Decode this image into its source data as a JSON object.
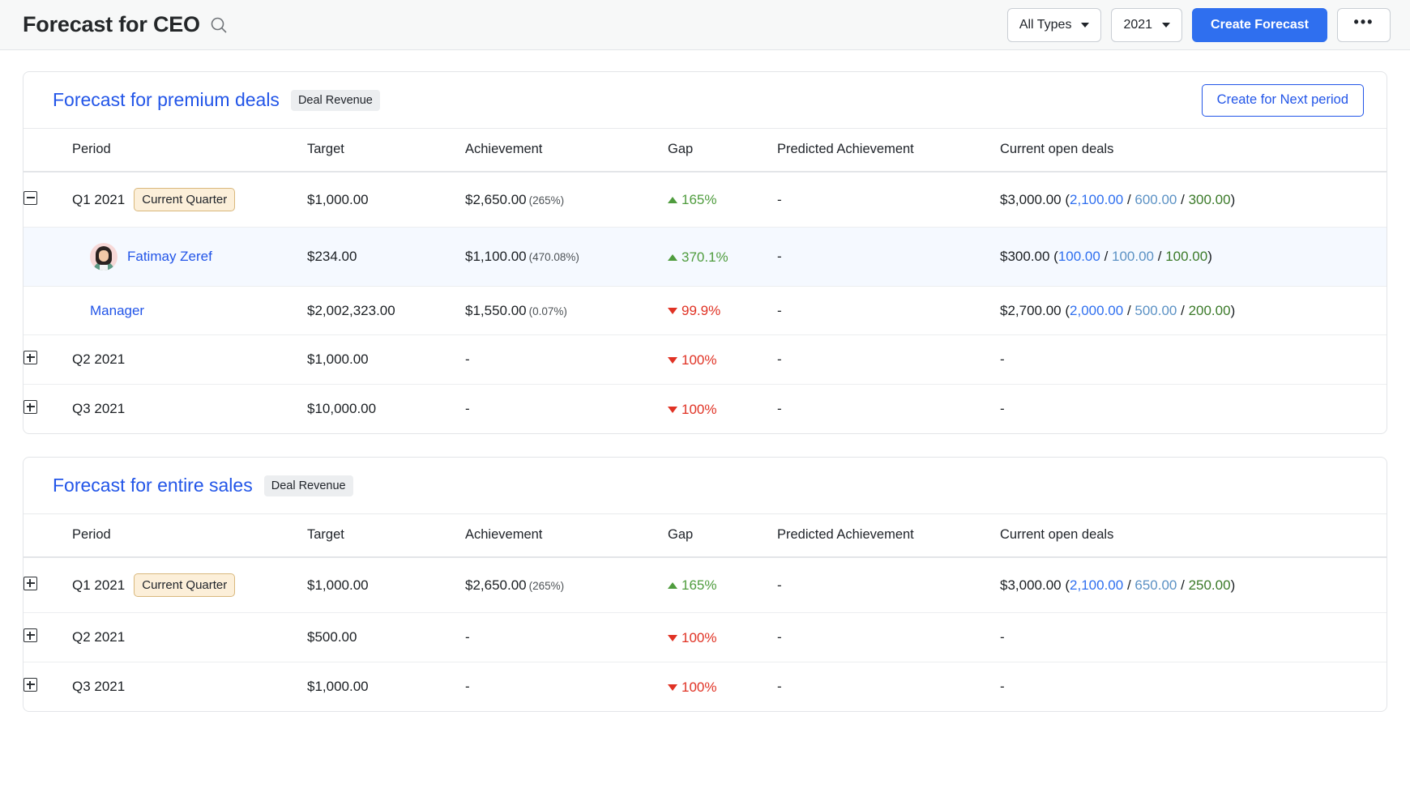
{
  "header": {
    "title": "Forecast for CEO",
    "search_icon": "search-icon",
    "type_filter": "All Types",
    "year_filter": "2021",
    "create_button": "Create Forecast",
    "more_button": "•••"
  },
  "columns": [
    "Period",
    "Target",
    "Achievement",
    "Gap",
    "Predicted Achievement",
    "Current open deals"
  ],
  "cards": [
    {
      "title": "Forecast for premium deals",
      "tag": "Deal Revenue",
      "action": "Create for Next period",
      "rows": [
        {
          "toggle": "minus",
          "type": "period",
          "period": "Q1 2021",
          "badge": "Current Quarter",
          "target": "$1,000.00",
          "achievement": "$2,650.00",
          "achievement_pct": "(265%)",
          "gap": "165%",
          "gap_dir": "up",
          "predicted": "-",
          "open_total": "$3,000.00",
          "open_a": "2,100.00",
          "open_b": "600.00",
          "open_c": "300.00",
          "highlight": false
        },
        {
          "toggle": "none",
          "type": "user",
          "period": "Fatimay Zeref",
          "badge": "",
          "target": "$234.00",
          "achievement": "$1,100.00",
          "achievement_pct": "(470.08%)",
          "gap": "370.1%",
          "gap_dir": "up",
          "predicted": "-",
          "open_total": "$300.00",
          "open_a": "100.00",
          "open_b": "100.00",
          "open_c": "100.00",
          "highlight": true
        },
        {
          "toggle": "none",
          "type": "manager",
          "period": "Manager",
          "badge": "",
          "target": "$2,002,323.00",
          "achievement": "$1,550.00",
          "achievement_pct": "(0.07%)",
          "gap": "99.9%",
          "gap_dir": "down",
          "predicted": "-",
          "open_total": "$2,700.00",
          "open_a": "2,000.00",
          "open_b": "500.00",
          "open_c": "200.00",
          "highlight": false
        },
        {
          "toggle": "plus",
          "type": "period",
          "period": "Q2 2021",
          "badge": "",
          "target": "$1,000.00",
          "achievement": "-",
          "achievement_pct": "",
          "gap": "100%",
          "gap_dir": "down",
          "predicted": "-",
          "open_total": "-",
          "open_a": "",
          "open_b": "",
          "open_c": "",
          "highlight": false
        },
        {
          "toggle": "plus",
          "type": "period",
          "period": "Q3 2021",
          "badge": "",
          "target": "$10,000.00",
          "achievement": "-",
          "achievement_pct": "",
          "gap": "100%",
          "gap_dir": "down",
          "predicted": "-",
          "open_total": "-",
          "open_a": "",
          "open_b": "",
          "open_c": "",
          "highlight": false
        }
      ]
    },
    {
      "title": "Forecast for entire sales",
      "tag": "Deal Revenue",
      "action": "",
      "rows": [
        {
          "toggle": "plus",
          "type": "period",
          "period": "Q1 2021",
          "badge": "Current Quarter",
          "target": "$1,000.00",
          "achievement": "$2,650.00",
          "achievement_pct": "(265%)",
          "gap": "165%",
          "gap_dir": "up",
          "predicted": "-",
          "open_total": "$3,000.00",
          "open_a": "2,100.00",
          "open_b": "650.00",
          "open_c": "250.00",
          "highlight": false
        },
        {
          "toggle": "plus",
          "type": "period",
          "period": "Q2 2021",
          "badge": "",
          "target": "$500.00",
          "achievement": "-",
          "achievement_pct": "",
          "gap": "100%",
          "gap_dir": "down",
          "predicted": "-",
          "open_total": "-",
          "open_a": "",
          "open_b": "",
          "open_c": "",
          "highlight": false
        },
        {
          "toggle": "plus",
          "type": "period",
          "period": "Q3 2021",
          "badge": "",
          "target": "$1,000.00",
          "achievement": "-",
          "achievement_pct": "",
          "gap": "100%",
          "gap_dir": "down",
          "predicted": "-",
          "open_total": "-",
          "open_a": "",
          "open_b": "",
          "open_c": "",
          "highlight": false
        }
      ]
    }
  ],
  "colors": {
    "primary": "#2f6fef",
    "link": "#2255e8",
    "positive": "#4f9c3e",
    "negative": "#e03224",
    "open_a": "#2f6fef",
    "open_b": "#5b91c4",
    "open_c": "#3b7a29",
    "badge_bg": "#fcefd9"
  }
}
